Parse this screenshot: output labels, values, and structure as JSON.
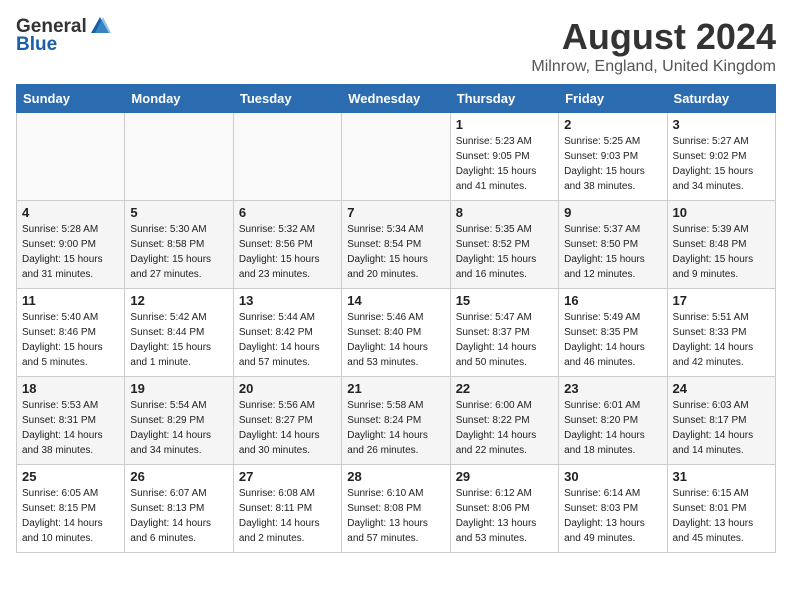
{
  "header": {
    "logo_general": "General",
    "logo_blue": "Blue",
    "month_year": "August 2024",
    "location": "Milnrow, England, United Kingdom"
  },
  "weekdays": [
    "Sunday",
    "Monday",
    "Tuesday",
    "Wednesday",
    "Thursday",
    "Friday",
    "Saturday"
  ],
  "weeks": [
    [
      {
        "day": "",
        "info": ""
      },
      {
        "day": "",
        "info": ""
      },
      {
        "day": "",
        "info": ""
      },
      {
        "day": "",
        "info": ""
      },
      {
        "day": "1",
        "info": "Sunrise: 5:23 AM\nSunset: 9:05 PM\nDaylight: 15 hours\nand 41 minutes."
      },
      {
        "day": "2",
        "info": "Sunrise: 5:25 AM\nSunset: 9:03 PM\nDaylight: 15 hours\nand 38 minutes."
      },
      {
        "day": "3",
        "info": "Sunrise: 5:27 AM\nSunset: 9:02 PM\nDaylight: 15 hours\nand 34 minutes."
      }
    ],
    [
      {
        "day": "4",
        "info": "Sunrise: 5:28 AM\nSunset: 9:00 PM\nDaylight: 15 hours\nand 31 minutes."
      },
      {
        "day": "5",
        "info": "Sunrise: 5:30 AM\nSunset: 8:58 PM\nDaylight: 15 hours\nand 27 minutes."
      },
      {
        "day": "6",
        "info": "Sunrise: 5:32 AM\nSunset: 8:56 PM\nDaylight: 15 hours\nand 23 minutes."
      },
      {
        "day": "7",
        "info": "Sunrise: 5:34 AM\nSunset: 8:54 PM\nDaylight: 15 hours\nand 20 minutes."
      },
      {
        "day": "8",
        "info": "Sunrise: 5:35 AM\nSunset: 8:52 PM\nDaylight: 15 hours\nand 16 minutes."
      },
      {
        "day": "9",
        "info": "Sunrise: 5:37 AM\nSunset: 8:50 PM\nDaylight: 15 hours\nand 12 minutes."
      },
      {
        "day": "10",
        "info": "Sunrise: 5:39 AM\nSunset: 8:48 PM\nDaylight: 15 hours\nand 9 minutes."
      }
    ],
    [
      {
        "day": "11",
        "info": "Sunrise: 5:40 AM\nSunset: 8:46 PM\nDaylight: 15 hours\nand 5 minutes."
      },
      {
        "day": "12",
        "info": "Sunrise: 5:42 AM\nSunset: 8:44 PM\nDaylight: 15 hours\nand 1 minute."
      },
      {
        "day": "13",
        "info": "Sunrise: 5:44 AM\nSunset: 8:42 PM\nDaylight: 14 hours\nand 57 minutes."
      },
      {
        "day": "14",
        "info": "Sunrise: 5:46 AM\nSunset: 8:40 PM\nDaylight: 14 hours\nand 53 minutes."
      },
      {
        "day": "15",
        "info": "Sunrise: 5:47 AM\nSunset: 8:37 PM\nDaylight: 14 hours\nand 50 minutes."
      },
      {
        "day": "16",
        "info": "Sunrise: 5:49 AM\nSunset: 8:35 PM\nDaylight: 14 hours\nand 46 minutes."
      },
      {
        "day": "17",
        "info": "Sunrise: 5:51 AM\nSunset: 8:33 PM\nDaylight: 14 hours\nand 42 minutes."
      }
    ],
    [
      {
        "day": "18",
        "info": "Sunrise: 5:53 AM\nSunset: 8:31 PM\nDaylight: 14 hours\nand 38 minutes."
      },
      {
        "day": "19",
        "info": "Sunrise: 5:54 AM\nSunset: 8:29 PM\nDaylight: 14 hours\nand 34 minutes."
      },
      {
        "day": "20",
        "info": "Sunrise: 5:56 AM\nSunset: 8:27 PM\nDaylight: 14 hours\nand 30 minutes."
      },
      {
        "day": "21",
        "info": "Sunrise: 5:58 AM\nSunset: 8:24 PM\nDaylight: 14 hours\nand 26 minutes."
      },
      {
        "day": "22",
        "info": "Sunrise: 6:00 AM\nSunset: 8:22 PM\nDaylight: 14 hours\nand 22 minutes."
      },
      {
        "day": "23",
        "info": "Sunrise: 6:01 AM\nSunset: 8:20 PM\nDaylight: 14 hours\nand 18 minutes."
      },
      {
        "day": "24",
        "info": "Sunrise: 6:03 AM\nSunset: 8:17 PM\nDaylight: 14 hours\nand 14 minutes."
      }
    ],
    [
      {
        "day": "25",
        "info": "Sunrise: 6:05 AM\nSunset: 8:15 PM\nDaylight: 14 hours\nand 10 minutes."
      },
      {
        "day": "26",
        "info": "Sunrise: 6:07 AM\nSunset: 8:13 PM\nDaylight: 14 hours\nand 6 minutes."
      },
      {
        "day": "27",
        "info": "Sunrise: 6:08 AM\nSunset: 8:11 PM\nDaylight: 14 hours\nand 2 minutes."
      },
      {
        "day": "28",
        "info": "Sunrise: 6:10 AM\nSunset: 8:08 PM\nDaylight: 13 hours\nand 57 minutes."
      },
      {
        "day": "29",
        "info": "Sunrise: 6:12 AM\nSunset: 8:06 PM\nDaylight: 13 hours\nand 53 minutes."
      },
      {
        "day": "30",
        "info": "Sunrise: 6:14 AM\nSunset: 8:03 PM\nDaylight: 13 hours\nand 49 minutes."
      },
      {
        "day": "31",
        "info": "Sunrise: 6:15 AM\nSunset: 8:01 PM\nDaylight: 13 hours\nand 45 minutes."
      }
    ]
  ]
}
